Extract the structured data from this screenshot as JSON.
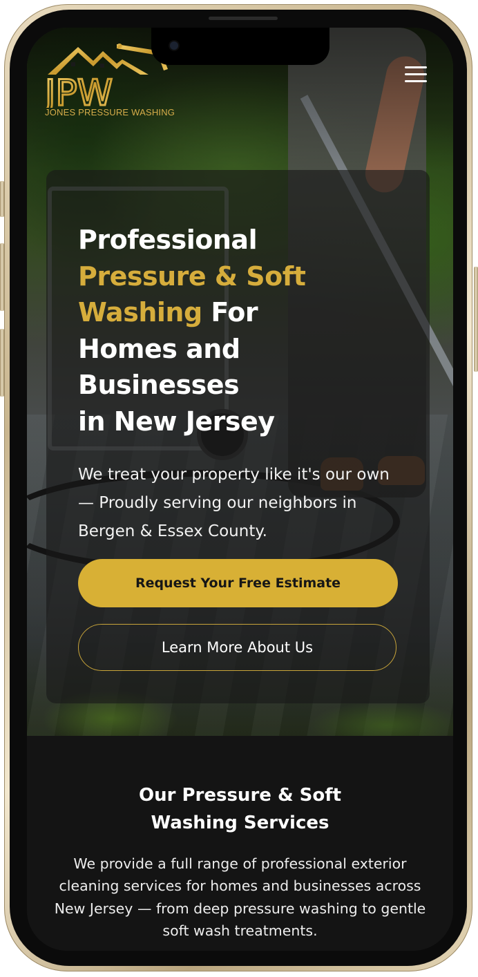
{
  "brand": {
    "logo_initials": "JPW",
    "logo_name": "JONES PRESSURE WASHING",
    "gold": "#d6ad3c"
  },
  "header": {
    "menu_icon": "hamburger-menu-icon"
  },
  "hero": {
    "headline_line1": "Professional",
    "headline_gold1": "Pressure & Soft",
    "headline_gold2": "Washing",
    "headline_after_gold": " For",
    "headline_line4": "Homes and",
    "headline_line5": "Businesses",
    "headline_line6": "in New Jersey",
    "subtext": "We treat your property like it's our own — Proudly serving our neighbors in Bergen & Essex County.",
    "primary_cta": "Request Your Free Estimate",
    "secondary_cta": "Learn More About Us"
  },
  "services": {
    "title_line1": "Our Pressure & Soft",
    "title_line2": "Washing Services",
    "description": "We provide a full range of professional exterior cleaning services for homes and businesses across New Jersey — from deep pressure washing to gentle soft wash treatments."
  }
}
